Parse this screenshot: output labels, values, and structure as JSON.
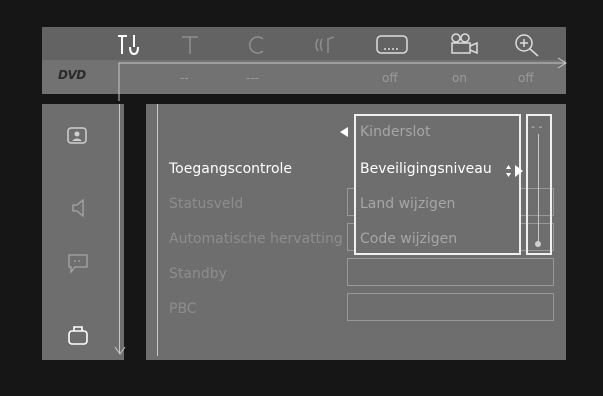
{
  "status_bar": {
    "disc_logo": "DVD",
    "values": [
      "--",
      "---",
      "off",
      "on",
      "off"
    ]
  },
  "top_icons": [
    "tools-icon",
    "subtitle-t-icon",
    "repeat-c-icon",
    "audio-icon",
    "subtitle-box-icon",
    "camera-angle-icon",
    "zoom-icon"
  ],
  "side_menu": [
    "picture-icon",
    "sound-icon",
    "language-icon",
    "features-icon"
  ],
  "settings": [
    {
      "label": "Toegangscontrole",
      "active": true
    },
    {
      "label": "Statusveld",
      "active": false
    },
    {
      "label": "Automatische hervatting",
      "active": false
    },
    {
      "label": "Standby",
      "active": false
    },
    {
      "label": "PBC",
      "active": false
    }
  ],
  "dropdown": {
    "options": [
      "Kinderslot",
      "Beveiligingsniveau",
      "Land wijzigen",
      "Code wijzigen"
    ],
    "selected_index": 1
  },
  "level_scale": {
    "top_label": "- -"
  }
}
